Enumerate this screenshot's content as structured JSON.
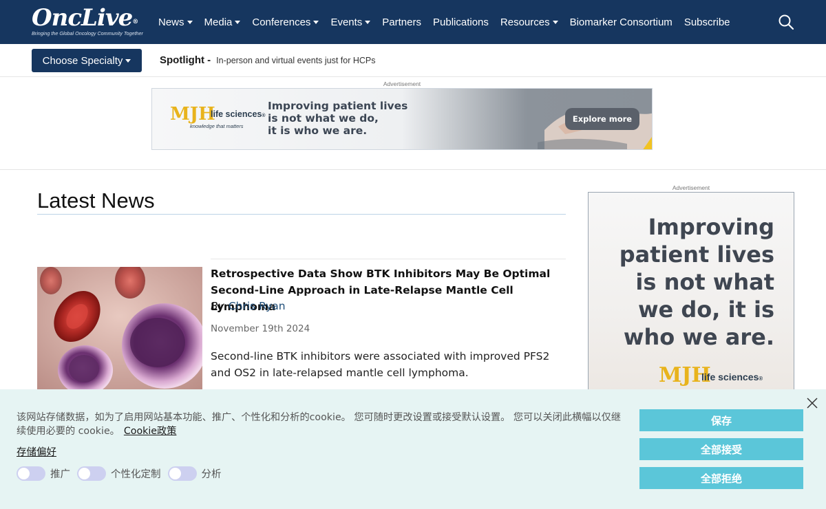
{
  "header": {
    "logo_text": "OncLive",
    "logo_reg": "®",
    "logo_tagline": "Bringing the Global Oncology Community Together",
    "nav": [
      {
        "label": "News",
        "dropdown": true
      },
      {
        "label": "Media",
        "dropdown": true
      },
      {
        "label": "Conferences",
        "dropdown": true
      },
      {
        "label": "Events",
        "dropdown": true
      },
      {
        "label": "Partners",
        "dropdown": false
      },
      {
        "label": "Publications",
        "dropdown": false
      },
      {
        "label": "Resources",
        "dropdown": true
      },
      {
        "label": "Biomarker Consortium",
        "dropdown": false
      },
      {
        "label": "Subscribe",
        "dropdown": false
      }
    ],
    "search_icon": "search-icon"
  },
  "subbar": {
    "specialty_label": "Choose Specialty",
    "spotlight_label": "Spotlight -",
    "spotlight_text": "In-person and virtual events just for HCPs"
  },
  "top_ad": {
    "label": "Advertisement",
    "brand_mark": "MJH",
    "brand_name": "life sciences",
    "brand_reg": "®",
    "brand_tagline": "knowledge that matters",
    "headline_lines": [
      "Improving patient lives",
      "is not what we do,",
      "it is who we are."
    ],
    "cta": "Explore more"
  },
  "latest_news": {
    "title": "Latest News",
    "article": {
      "headline": "Retrospective Data Show BTK Inhibitors May Be Optimal Second-Line Approach in Late-Relapse Mantle Cell Lymphoma",
      "by": "By",
      "author": "Chris Ryan",
      "date": "November 19th 2024",
      "summary": "Second-line BTK inhibitors were associated with improved PFS2 and OS2 in late-relapsed mantle cell lymphoma."
    }
  },
  "side_ad": {
    "label": "Advertisement",
    "headline_lines": [
      "Improving",
      "patient lives",
      "is not what",
      "we do, it is",
      "who we are."
    ],
    "brand_mark": "MJH",
    "brand_name": "life sciences",
    "brand_reg": "®"
  },
  "cookie": {
    "text": "该网站存储数据，如为了启用网站基本功能、推广、个性化和分析的cookie。 您可随时更改设置或接受默认设置。 您可以关闭此横幅以仅继续使用必要的 cookie。",
    "policy_link": "Cookie政策",
    "preferences_link": "存储偏好",
    "toggles": [
      "推广",
      "个性化定制",
      "分析"
    ],
    "buttons": {
      "save": "保存",
      "accept_all": "全部接受",
      "reject_all": "全部拒绝"
    }
  },
  "colors": {
    "nav_bg": "#16365f",
    "cookie_bg": "#e6f4f3",
    "cookie_button": "#5bc6d9",
    "ad_yellow": "#f2c322",
    "author_link": "#1f4e79"
  }
}
